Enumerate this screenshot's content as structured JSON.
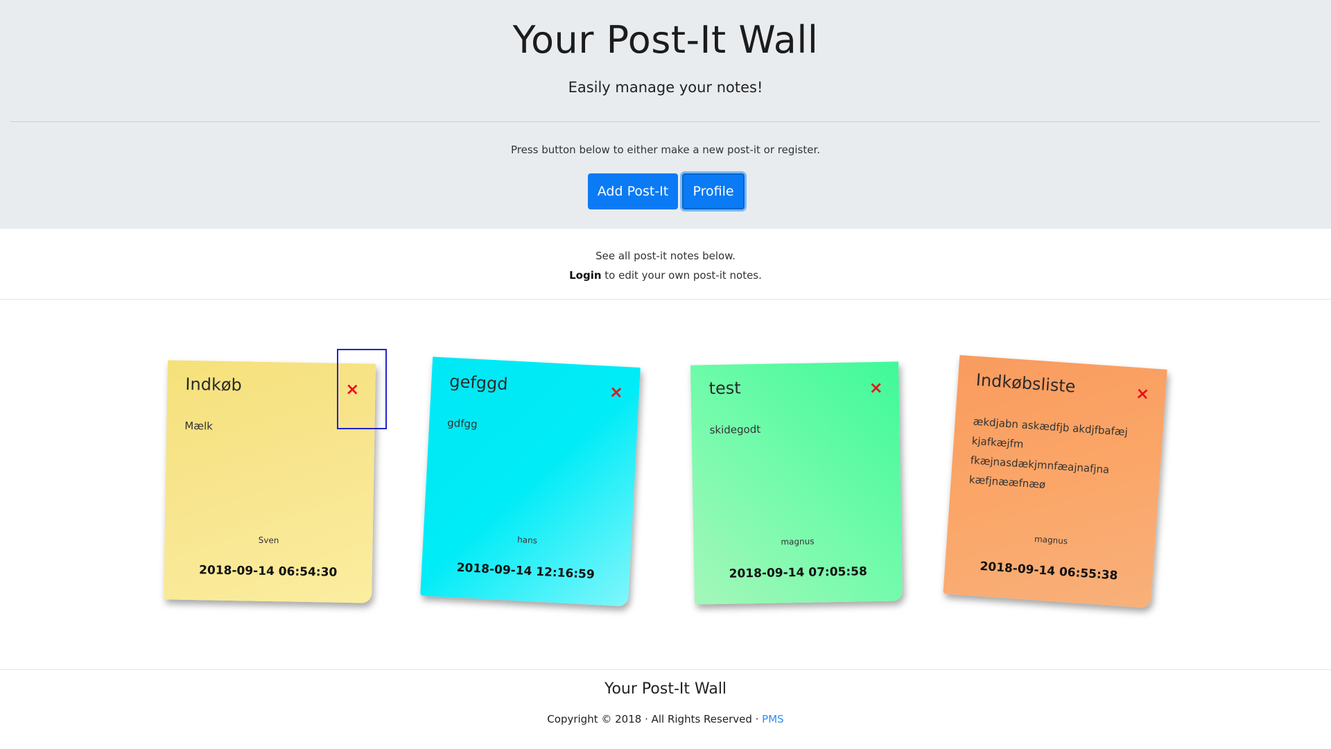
{
  "header": {
    "title": "Your Post-It Wall",
    "subtitle": "Easily manage your notes!",
    "lead": "Press button below to either make a new post-it or register.",
    "add_button": "Add Post-It",
    "profile_button": "Profile"
  },
  "info": {
    "line1": "See all post-it notes below.",
    "login_link": "Login",
    "line2_rest": " to edit your own post-it notes."
  },
  "notes": [
    {
      "title": "Indkøb",
      "body": "Mælk",
      "author": "Sven",
      "date": "2018-09-14 06:54:30",
      "color": "#f7e27e",
      "close_icon": "×"
    },
    {
      "title": "gefggd",
      "body": "gdfgg",
      "author": "hans",
      "date": "2018-09-14 12:16:59",
      "color": "#00eaf6",
      "close_icon": "×"
    },
    {
      "title": "test",
      "body": "skidegodt",
      "author": "magnus",
      "date": "2018-09-14 07:05:58",
      "color": "#6ffba8",
      "close_icon": "×"
    },
    {
      "title": "Indkøbsliste",
      "body": "ækdjabn askædfjb akdjfbafæj kjafkæjfm fkæjnasdækjmnfæajnafjna kæfjnææfnæø",
      "author": "magnus",
      "date": "2018-09-14 06:55:38",
      "color": "#faa566",
      "close_icon": "×"
    }
  ],
  "footer": {
    "title": "Your Post-It Wall",
    "copyright": "Copyright © 2018 · All Rights Reserved · ",
    "link": "PMS"
  },
  "colors": {
    "accent": "#0a7bf5",
    "close": "#e8121a",
    "link": "#2f8ef0"
  }
}
